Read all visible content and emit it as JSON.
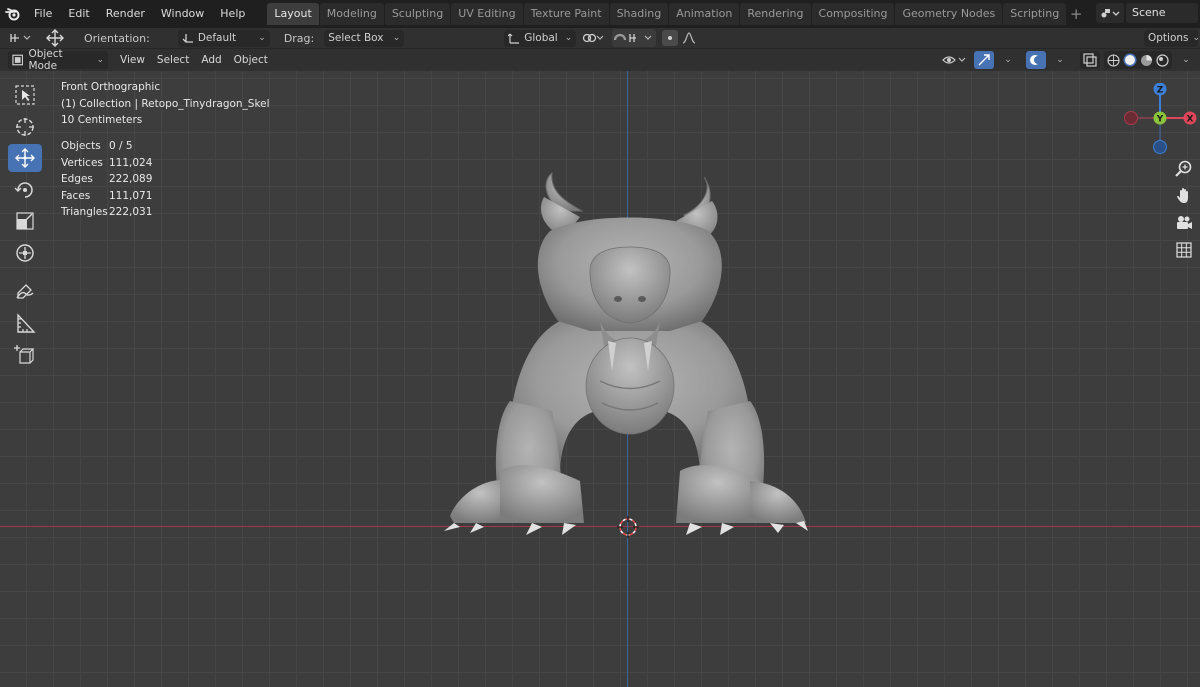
{
  "topbar": {
    "menus": [
      "File",
      "Edit",
      "Render",
      "Window",
      "Help"
    ],
    "workspaces": [
      "Layout",
      "Modeling",
      "Sculpting",
      "UV Editing",
      "Texture Paint",
      "Shading",
      "Animation",
      "Rendering",
      "Compositing",
      "Geometry Nodes",
      "Scripting"
    ],
    "active_workspace": "Layout",
    "add_workspace": "+",
    "scene_name": "Scene"
  },
  "toolbar": {
    "orientation_label": "Orientation:",
    "orientation_value": "Default",
    "drag_label": "Drag:",
    "drag_value": "Select Box",
    "transform_orientation": "Global",
    "options_label": "Options"
  },
  "viewport_header": {
    "mode": "Object Mode",
    "menus": [
      "View",
      "Select",
      "Add",
      "Object"
    ]
  },
  "viewport": {
    "view_name": "Front Orthographic",
    "collection": "(1) Collection | Retopo_Tinydragon_Skel",
    "scale": "10 Centimeters",
    "stats": [
      {
        "label": "Objects",
        "value": "0 / 5"
      },
      {
        "label": "Vertices",
        "value": "111,024"
      },
      {
        "label": "Edges",
        "value": "222,089"
      },
      {
        "label": "Faces",
        "value": "111,071"
      },
      {
        "label": "Triangles",
        "value": "222,031"
      }
    ],
    "gizmo_labels": {
      "z": "Z",
      "y": "Y",
      "x": "X"
    }
  },
  "colors": {
    "accent_blue": "#4772b3",
    "axis_x": "#a03a48",
    "axis_z": "#3f62a0",
    "gizmo_x": "#e0465a",
    "gizmo_y": "#8ac43a",
    "gizmo_z": "#3c7fd6"
  },
  "icons": [
    "blender-logo",
    "select-box-tool",
    "cursor-tool",
    "move-tool",
    "rotate-tool",
    "scale-tool",
    "transform-tool",
    "annotate-tool",
    "measure-tool",
    "add-cube-tool",
    "zoom-icon",
    "hand-pan-icon",
    "camera-icon",
    "grid-ortho-icon"
  ]
}
